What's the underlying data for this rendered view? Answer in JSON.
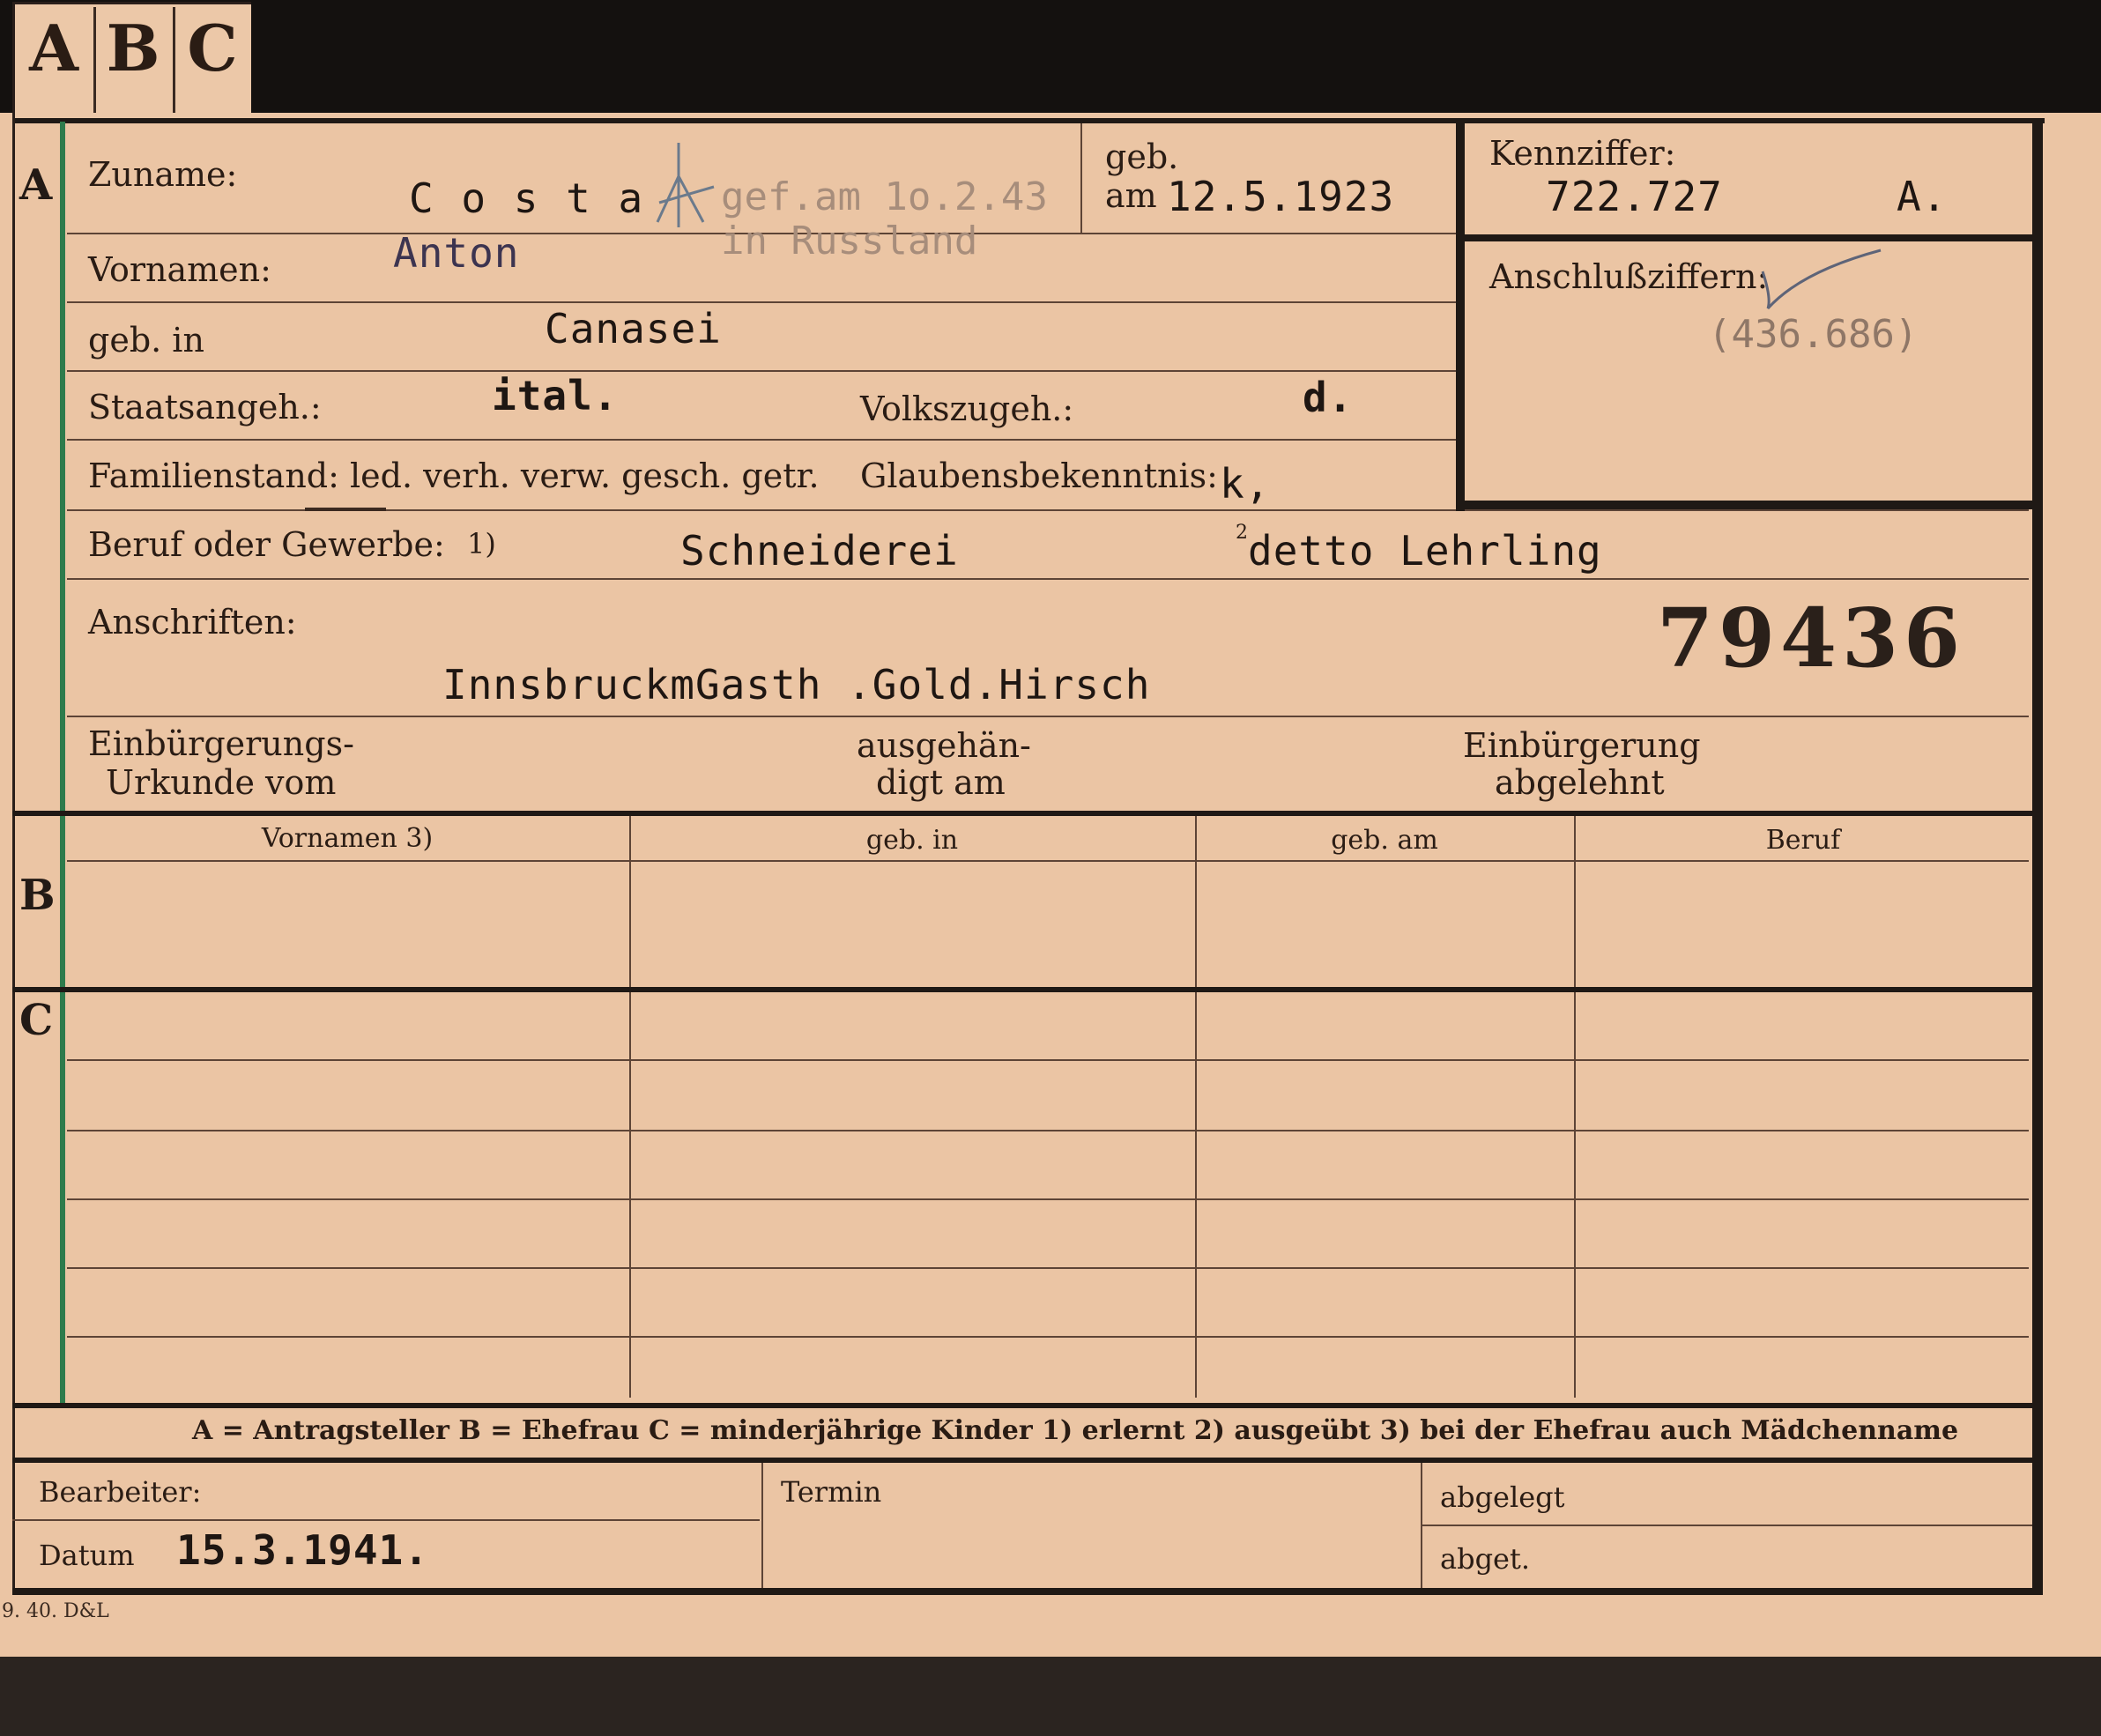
{
  "tab": {
    "a": "A",
    "b": "B",
    "c": "C"
  },
  "section_letters": {
    "a": "A",
    "b": "B",
    "c": "C"
  },
  "labels": {
    "zuname": "Zuname:",
    "vornamen": "Vornamen:",
    "geb_in": "geb. in",
    "staatsangeh": "Staatsangeh.:",
    "volkszugeh": "Volkszugeh.:",
    "familienstand": "Familienstand: led. verh. verw. gesch. getr.",
    "glaubensbekenntnis": "Glaubensbekenntnis:",
    "beruf": "Beruf oder Gewerbe:",
    "beruf_note": "1)",
    "anschriften": "Anschriften:",
    "einb_urkunde_1": "Einbürgerungs-",
    "einb_urkunde_2": "Urkunde vom",
    "ausgehaendigt_1": "ausgehän-",
    "ausgehaendigt_2": "digt am",
    "einb_abgelehnt_1": "Einbürgerung",
    "einb_abgelehnt_2": "abgelehnt",
    "geb_top": "geb.",
    "geb_am": "am",
    "kennziffer": "Kennziffer:",
    "anschlussziffern": "Anschlußziffern:"
  },
  "values": {
    "zuname": "C o s t a",
    "death_note_1": "gef.am 1o.2.43",
    "death_note_2": "in Russland",
    "vornamen": "Anton",
    "geb_in": "Canasei",
    "staatsangeh": "ital.",
    "volkszugeh": "d.",
    "glaubensbekenntnis": "k,",
    "geb_am": "12.5.1923",
    "kennziffer": "722.727",
    "kennziffer_suffix": "A.",
    "anschlussziffern": "(436.686)",
    "beruf_erlernt": "Schneiderei",
    "beruf_ausgeuebt_note": "2",
    "beruf_ausgeuebt": "detto Lehrling",
    "stamp_number": "79436",
    "anschrift": "InnsbruckmGasth .Gold.Hirsch"
  },
  "table": {
    "headers": [
      "Vornamen 3)",
      "geb. in",
      "geb. am",
      "Beruf"
    ]
  },
  "legend": "A = Antragsteller   B = Ehefrau   C = minderjährige Kinder   1) erlernt   2) ausgeübt   3) bei der Ehefrau auch Mädchenname",
  "footer": {
    "bearbeiter": "Bearbeiter:",
    "datum": "Datum",
    "datum_value": "15.3.1941.",
    "termin": "Termin",
    "abgelegt": "abgelegt",
    "abgetr": "abget."
  },
  "print_code": "9. 40. D&L"
}
